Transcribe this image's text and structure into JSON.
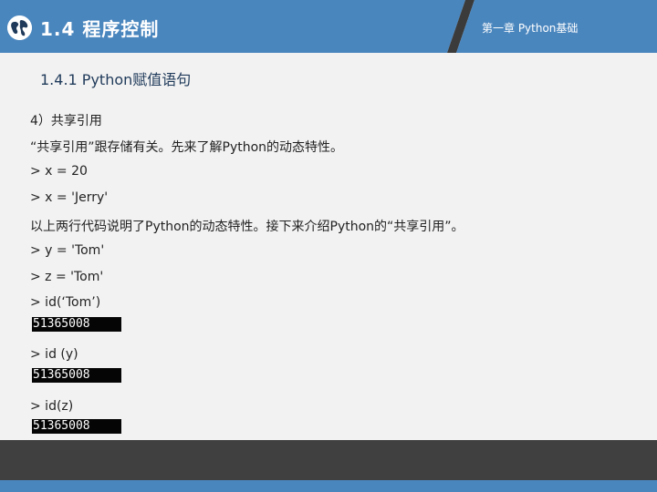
{
  "header": {
    "chapter_title": "1.4 程序控制",
    "chapter_label": "第一章 Python基础",
    "logo_icon": "globe-icon",
    "colors": {
      "blue": "#4a86be",
      "dark_slant": "#3b3b3b"
    }
  },
  "section": {
    "title": "1.4.1 Python赋值语句"
  },
  "lines": [
    "4）共享引用",
    "“共享引用”跟存储有关。先来了解Python的动态特性。",
    "> x = 20",
    "> x = 'Jerry'",
    "以上两行代码说明了Python的动态特性。接下来介绍Python的“共享引用”。",
    "> y = 'Tom'",
    "> z = 'Tom'",
    "> id(‘Tom’)",
    "> id (y)",
    "> id(z)"
  ],
  "outputs": [
    "51365008",
    "51365008",
    "51365008"
  ],
  "footer": {
    "colors": {
      "dark": "#404040",
      "blue": "#4a86be"
    }
  }
}
